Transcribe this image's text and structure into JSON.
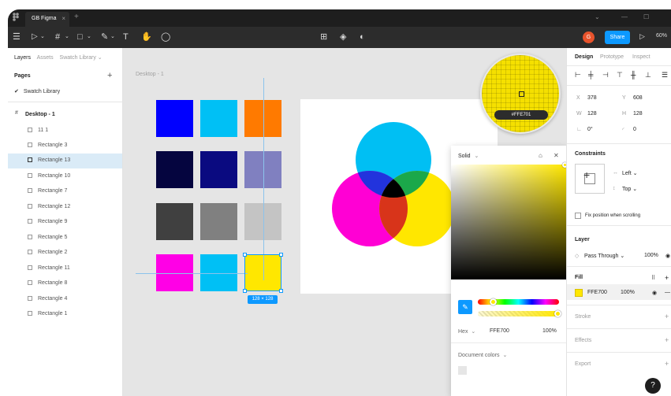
{
  "app": {
    "tab_title": "GB Figma",
    "tab_close": "×",
    "new_tab": "+",
    "app_logo": "figma-logo-icon"
  },
  "window_controls": {
    "chevron": "⌄",
    "minimize": "—",
    "maximize": "☐"
  },
  "toolbar": {
    "menu_icon": "☰",
    "move_tool": "▷",
    "frame_tool": "#",
    "shape_tool": "□",
    "pen_tool": "✎",
    "text_tool": "T",
    "hand_tool": "✋",
    "comment_tool": "◯",
    "dropdown_caret": "⌄",
    "center_tools": [
      "⊞",
      "◈",
      "◐"
    ],
    "avatar_initial": "G",
    "share_label": "Share",
    "present_icon": "▷",
    "zoom_label": "60%"
  },
  "left_panel": {
    "tabs": [
      "Layers",
      "Assets",
      "Swatch Library ⌄"
    ],
    "pages_heading": "Pages",
    "pages_add": "+",
    "current_page": "Swatch Library",
    "current_page_check": "✔",
    "frame_icon": "#",
    "frame_name": "Desktop - 1",
    "layers": [
      "11 1",
      "Rectangle 3",
      "Rectangle 13",
      "Rectangle 10",
      "Rectangle 7",
      "Rectangle 12",
      "Rectangle 9",
      "Rectangle 5",
      "Rectangle 2",
      "Rectangle 11",
      "Rectangle 8",
      "Rectangle 4",
      "Rectangle 1"
    ],
    "selected_layer": "Rectangle 13"
  },
  "canvas": {
    "frame_label": "Desktop - 1",
    "swatches": [
      "#0000ff",
      "#00c0f5",
      "#ff7a00",
      "#05053f",
      "#0a0a80",
      "#8080c0",
      "#404040",
      "#808080",
      "#c4c4c4",
      "#ff00e6",
      "#00c0f5",
      "#ffe700"
    ],
    "selection_size": "128 × 128",
    "loupe_hex": "#FFE701",
    "cmy_circles": {
      "cyan": "#00bff3",
      "magenta": "#ff00d4",
      "yellow": "#ffe700"
    }
  },
  "color_picker": {
    "mode": "Solid",
    "mode_caret": "⌄",
    "style_icon": "⌂",
    "close_icon": "✕",
    "eyedropper_icon": "✎",
    "format_label": "Hex",
    "format_caret": "⌄",
    "hex_value": "FFE700",
    "opacity": "100%",
    "document_colors_label": "Document colors",
    "document_colors_caret": "⌄",
    "current_color": "#ffe700"
  },
  "right_panel": {
    "tabs": [
      "Design",
      "Prototype",
      "Inspect"
    ],
    "align_icons": [
      "⊢",
      "╪",
      "⊣",
      "⊤",
      "╫",
      "⊥",
      "☰"
    ],
    "position": {
      "x_label": "X",
      "x": "378",
      "y_label": "Y",
      "y": "608"
    },
    "size": {
      "w_label": "W",
      "w": "128",
      "h_label": "H",
      "h": "128"
    },
    "rotation_label": "∟",
    "rotation": "0°",
    "radius_label": "◜",
    "radius": "0",
    "constraints_heading": "Constraints",
    "constraint_h_icon": "↔",
    "constraint_h": "Left ⌄",
    "constraint_v_icon": "↕",
    "constraint_v": "Top ⌄",
    "fix_scroll": "Fix position when scrolling",
    "layer_heading": "Layer",
    "blend_icon": "◇",
    "blend": "Pass Through ⌄",
    "layer_opacity": "100%",
    "layer_eye": "◉",
    "fill_heading": "Fill",
    "fill_styles_icon": "⠿",
    "fill_add": "+",
    "fill_hex": "FFE700",
    "fill_opacity": "100%",
    "fill_eye": "◉",
    "fill_remove": "—",
    "stroke_heading": "Stroke",
    "effects_heading": "Effects",
    "export_heading": "Export",
    "section_add": "+"
  },
  "help_label": "?"
}
